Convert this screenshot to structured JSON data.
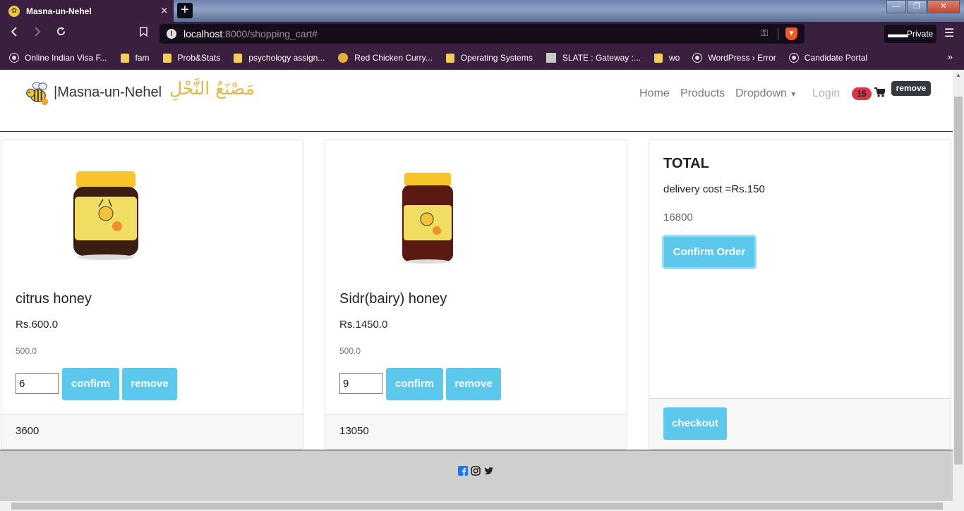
{
  "browser": {
    "tab_title": "Masna-un-Nehel",
    "tab_close": "×",
    "new_tab": "+",
    "url_host": "localhost",
    "url_path": ":8000/shopping_cart#",
    "private_label": "Private",
    "bookmarks": [
      {
        "label": "Online Indian Visa F...",
        "icon": "globe-icon"
      },
      {
        "label": "fam",
        "icon": "folder-icon"
      },
      {
        "label": "Prob&Stats",
        "icon": "folder-icon"
      },
      {
        "label": "psychology assign...",
        "icon": "folder-icon"
      },
      {
        "label": "Red Chicken Curry...",
        "icon": "site-icon"
      },
      {
        "label": "Operating Systems",
        "icon": "folder-icon"
      },
      {
        "label": "SLATE : Gateway :...",
        "icon": "slate-icon"
      },
      {
        "label": "wo",
        "icon": "folder-icon"
      },
      {
        "label": "WordPress › Error",
        "icon": "globe-icon"
      },
      {
        "label": "Candidate Portal",
        "icon": "globe-icon"
      }
    ],
    "more_bookmarks": "»"
  },
  "site": {
    "brand": "|Masna-un-Nehel",
    "brand_arabic": "مَصْنَعُ النَّحْلِ",
    "nav": {
      "home": "Home",
      "products": "Products",
      "dropdown": "Dropdown",
      "login": "Login"
    },
    "cart_count": "15",
    "remove_tag": "remove"
  },
  "cart": {
    "items": [
      {
        "name": "citrus honey",
        "price": "Rs.600.0",
        "weight": "500.0",
        "qty": "6",
        "confirm": "confirm",
        "remove": "remove",
        "subtotal": "3600"
      },
      {
        "name": "Sidr(bairy) honey",
        "price": "Rs.1450.0",
        "weight": "500.0",
        "qty": "9",
        "confirm": "confirm",
        "remove": "remove",
        "subtotal": "13050"
      }
    ],
    "total": {
      "title": "TOTAL",
      "delivery": "delivery cost =Rs.150",
      "amount": "16800",
      "confirm_order": "Confirm Order",
      "checkout": "checkout"
    }
  },
  "colors": {
    "accent": "#5bc8ec",
    "badge": "#dc3545",
    "chrome": "#3a1f3e",
    "footer": "#cfcfcf"
  }
}
